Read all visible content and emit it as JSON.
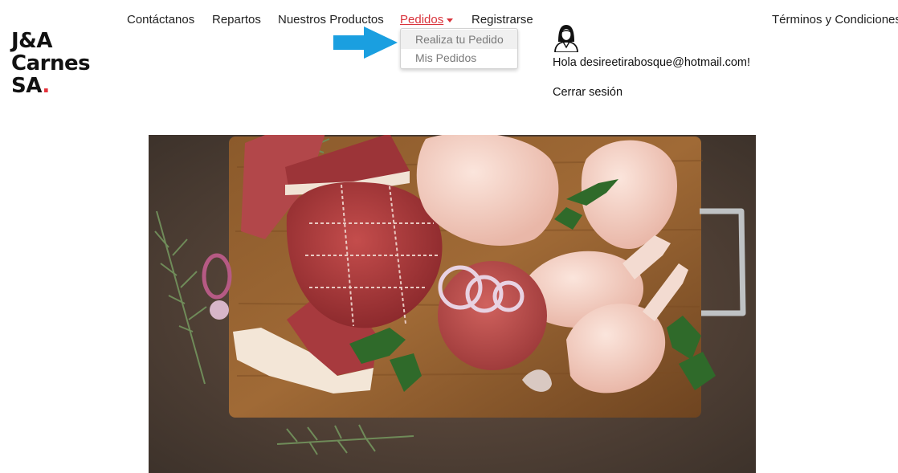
{
  "brand": {
    "line1": "J&A",
    "line2": "Carnes",
    "line3": "SA",
    "dot": ".",
    "accent_color": "#e5323b"
  },
  "nav": {
    "contact": "Contáctanos",
    "deliveries": "Repartos",
    "products": "Nuestros Productos",
    "orders": "Pedidos",
    "register": "Registrarse",
    "terms": "Términos y Condiciones"
  },
  "orders_menu": {
    "items": [
      "Realiza tu Pedido",
      "Mis Pedidos"
    ]
  },
  "user": {
    "icon": "user-avatar-icon",
    "greeting": "Hola desireetirabosque@hotmail.com!",
    "logout": "Cerrar sesión"
  },
  "annotation": {
    "icon": "arrow-right-icon",
    "color": "#1a9fe0"
  },
  "hero": {
    "icon": "meat-and-poultry-photo"
  }
}
